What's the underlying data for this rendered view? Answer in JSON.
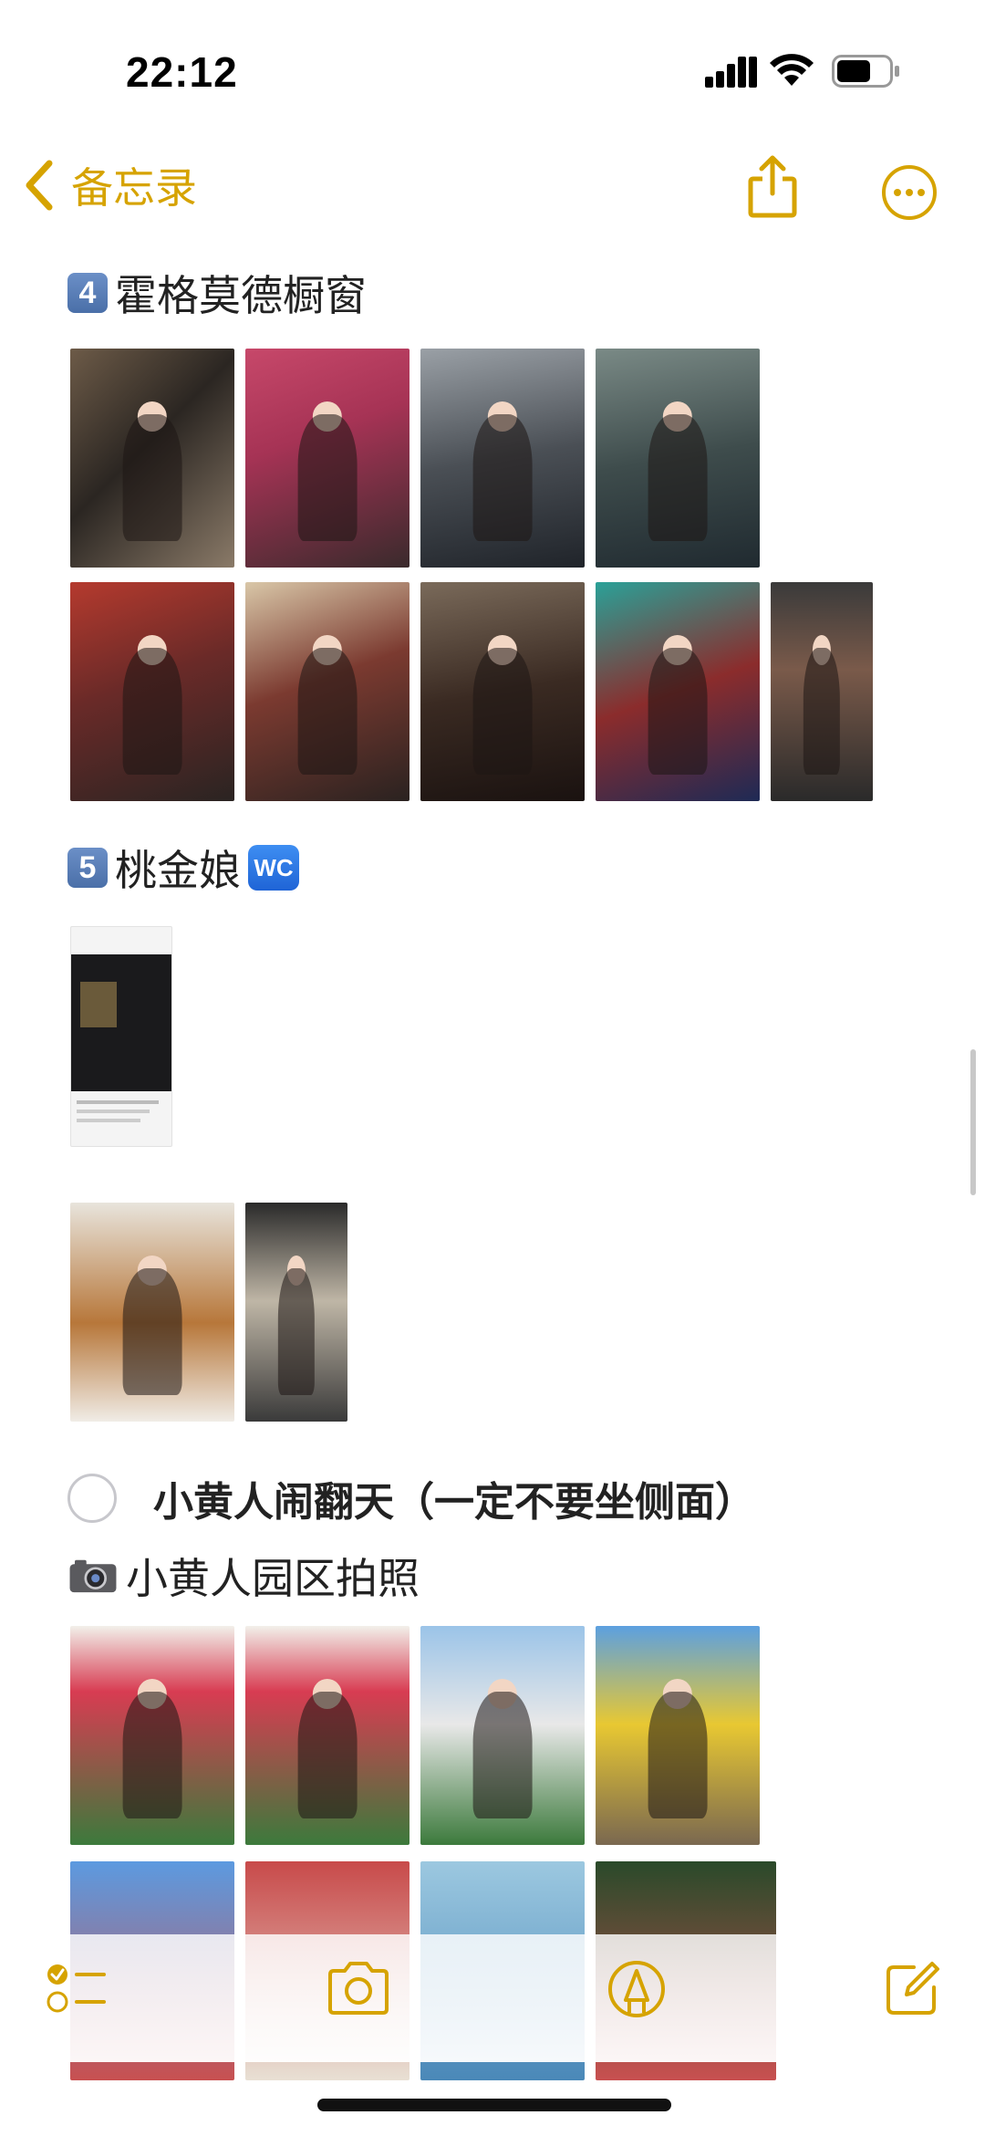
{
  "status": {
    "time": "22:12"
  },
  "nav": {
    "back_label": "备忘录"
  },
  "sections": [
    {
      "badge": "4",
      "title": "霍格莫德橱窗"
    },
    {
      "badge": "5",
      "title": "桃金娘",
      "trailing_badge": "WC"
    }
  ],
  "todo": {
    "text": "小黄人闹翻天（一定不要坐侧面）",
    "checked": false
  },
  "photo_section": {
    "title": "小黄人园区拍照"
  },
  "icons": {
    "back": "chevron-left-icon",
    "share": "share-icon",
    "more": "ellipsis-circle-icon",
    "checklist": "checklist-icon",
    "camera": "camera-icon",
    "markup": "markup-pen-icon",
    "compose": "compose-icon"
  },
  "accent_color": "#d6a300"
}
